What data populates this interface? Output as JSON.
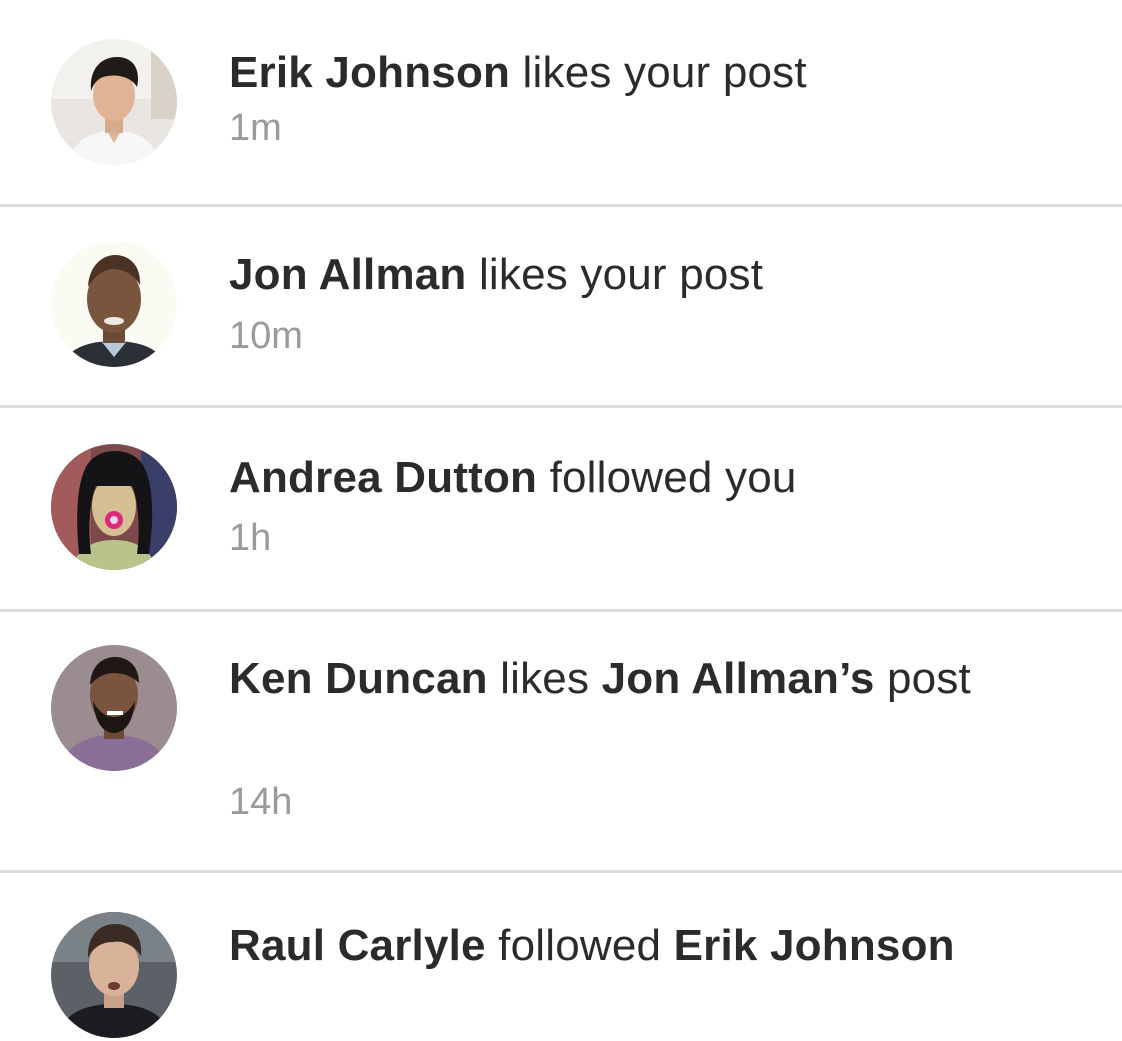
{
  "notifications": [
    {
      "actor": "Erik Johnson",
      "action": " likes your post",
      "time": "1m",
      "avatar_icon": "avatar-photo-erik-johnson"
    },
    {
      "actor": "Jon Allman",
      "action": " likes your post",
      "time": "10m",
      "avatar_icon": "avatar-photo-jon-allman"
    },
    {
      "actor": "Andrea Dutton",
      "action": " followed you",
      "time": "1h",
      "avatar_icon": "avatar-photo-andrea-dutton"
    },
    {
      "actor": "Ken Duncan",
      "action": " likes ",
      "target": "Jon Allman’s",
      "action_tail": " post",
      "time": "14h",
      "avatar_icon": "avatar-photo-ken-duncan"
    },
    {
      "actor": "Raul Carlyle",
      "action": " followed ",
      "target": "Erik Johnson",
      "avatar_icon": "avatar-photo-raul-carlyle"
    }
  ],
  "colors": {
    "text": "#2b2b2b",
    "time": "#9a9a9a",
    "divider": "#dcdcdc",
    "background": "#ffffff"
  }
}
